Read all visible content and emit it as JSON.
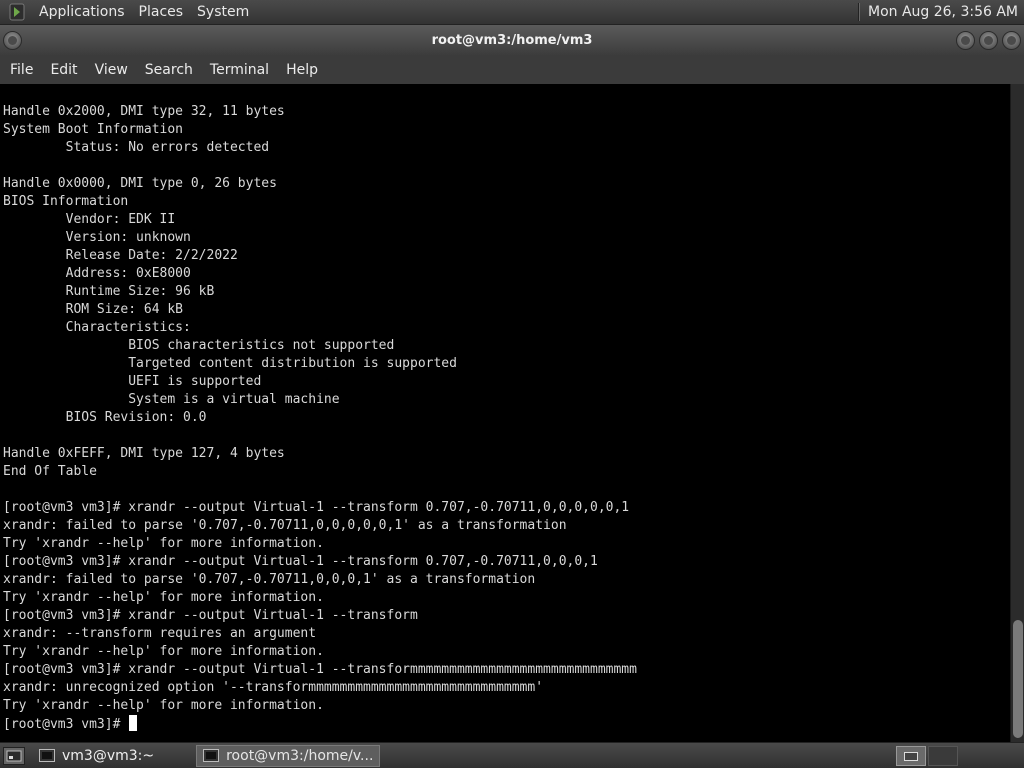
{
  "top_panel": {
    "apps_icon": "gnome-foot-icon",
    "menus": [
      "Applications",
      "Places",
      "System"
    ],
    "clock": "Mon Aug 26,  3:56 AM"
  },
  "window": {
    "title": "root@vm3:/home/vm3"
  },
  "menubar": [
    "File",
    "Edit",
    "View",
    "Search",
    "Terminal",
    "Help"
  ],
  "terminal": {
    "lines": [
      "Handle 0x2000, DMI type 32, 11 bytes",
      "System Boot Information",
      "        Status: No errors detected",
      "",
      "Handle 0x0000, DMI type 0, 26 bytes",
      "BIOS Information",
      "        Vendor: EDK II",
      "        Version: unknown",
      "        Release Date: 2/2/2022",
      "        Address: 0xE8000",
      "        Runtime Size: 96 kB",
      "        ROM Size: 64 kB",
      "        Characteristics:",
      "                BIOS characteristics not supported",
      "                Targeted content distribution is supported",
      "                UEFI is supported",
      "                System is a virtual machine",
      "        BIOS Revision: 0.0",
      "",
      "Handle 0xFEFF, DMI type 127, 4 bytes",
      "End Of Table",
      "",
      "[root@vm3 vm3]# xrandr --output Virtual-1 --transform 0.707,-0.70711,0,0,0,0,0,1",
      "xrandr: failed to parse '0.707,-0.70711,0,0,0,0,0,1' as a transformation",
      "Try 'xrandr --help' for more information.",
      "[root@vm3 vm3]# xrandr --output Virtual-1 --transform 0.707,-0.70711,0,0,0,1",
      "xrandr: failed to parse '0.707,-0.70711,0,0,0,1' as a transformation",
      "Try 'xrandr --help' for more information.",
      "[root@vm3 vm3]# xrandr --output Virtual-1 --transform",
      "xrandr: --transform requires an argument",
      "Try 'xrandr --help' for more information.",
      "[root@vm3 vm3]# xrandr --output Virtual-1 --transformmmmmmmmmmmmmmmmmmmmmmmmmmmmm",
      "xrandr: unrecognized option '--transformmmmmmmmmmmmmmmmmmmmmmmmmmmmm'",
      "Try 'xrandr --help' for more information."
    ],
    "prompt": "[root@vm3 vm3]# "
  },
  "taskbar": {
    "tasks": [
      {
        "label": "vm3@vm3:~",
        "active": false
      },
      {
        "label": "root@vm3:/home/v...",
        "active": true
      }
    ]
  }
}
